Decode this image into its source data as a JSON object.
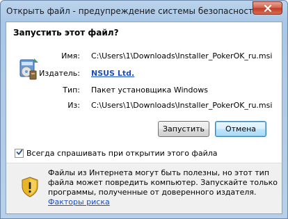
{
  "window": {
    "title": "Открыть файл - предупреждение системы безопасности"
  },
  "dialog": {
    "heading": "Запустить этот файл?",
    "fields": {
      "name_label": "Имя:",
      "name_value": "C:\\Users\\1\\Downloads\\Installer_PokerOK_ru.msi",
      "publisher_label": "Издатель:",
      "publisher_value": "NSUS Ltd.",
      "type_label": "Тип:",
      "type_value": "Пакет установщика Windows",
      "from_label": "Из:",
      "from_value": "C:\\Users\\1\\Downloads\\Installer_PokerOK_ru.msi"
    },
    "buttons": {
      "run": "Запустить",
      "cancel": "Отмена"
    },
    "checkbox": {
      "label": "Всегда спрашивать при открытии этого файла",
      "checked": true
    },
    "warning": {
      "text": "Файлы из Интернета могут быть полезны, но этот тип файла может повредить компьютер. Запускайте только программы, полученные от доверенного издателя.",
      "link": "Факторы риска"
    }
  },
  "icons": {
    "close": "close-icon",
    "app": "installer-package-icon",
    "warning": "security-shield-icon",
    "check": "check-icon"
  },
  "colors": {
    "link": "#1c4fbf",
    "close_button": "#c03a23",
    "default_button_border": "#3c7fb1"
  }
}
